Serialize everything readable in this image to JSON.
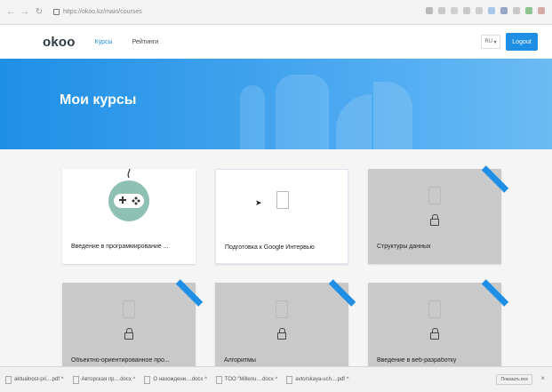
{
  "browser": {
    "url": "https://okoo.kz/main/courses",
    "nav_icons": [
      "back-icon",
      "forward-icon",
      "reload-icon"
    ],
    "extensions_count": 10
  },
  "header": {
    "logo": "okoo",
    "nav": [
      "Курсы",
      "Рейтинги"
    ],
    "lang": "RU",
    "logout": "Logout"
  },
  "hero": {
    "title": "Мои курсы"
  },
  "courses": [
    {
      "title": "Введение в программирование ...",
      "locked": false,
      "new": false
    },
    {
      "title": "Подготовка к Google Интервью",
      "locked": false,
      "new": false
    },
    {
      "title": "Структуры данных",
      "locked": true,
      "new": true
    },
    {
      "title": "Объектно-ориентированное про...",
      "locked": true,
      "new": true
    },
    {
      "title": "Алгоритмы",
      "locked": true,
      "new": true
    },
    {
      "title": "Введение в веб-разработку",
      "locked": true,
      "new": true
    }
  ],
  "downloads": [
    "aktualnost-pri....pdf",
    "Авторская пр....docx",
    "О нахождени....docx",
    "ТОО \"Millenu....docx",
    "avtorskaya-uch....pdf"
  ],
  "downloads_show_all": "Показать все",
  "colors": {
    "accent": "#1f8fe6",
    "locked_card": "#c9c9c9"
  }
}
